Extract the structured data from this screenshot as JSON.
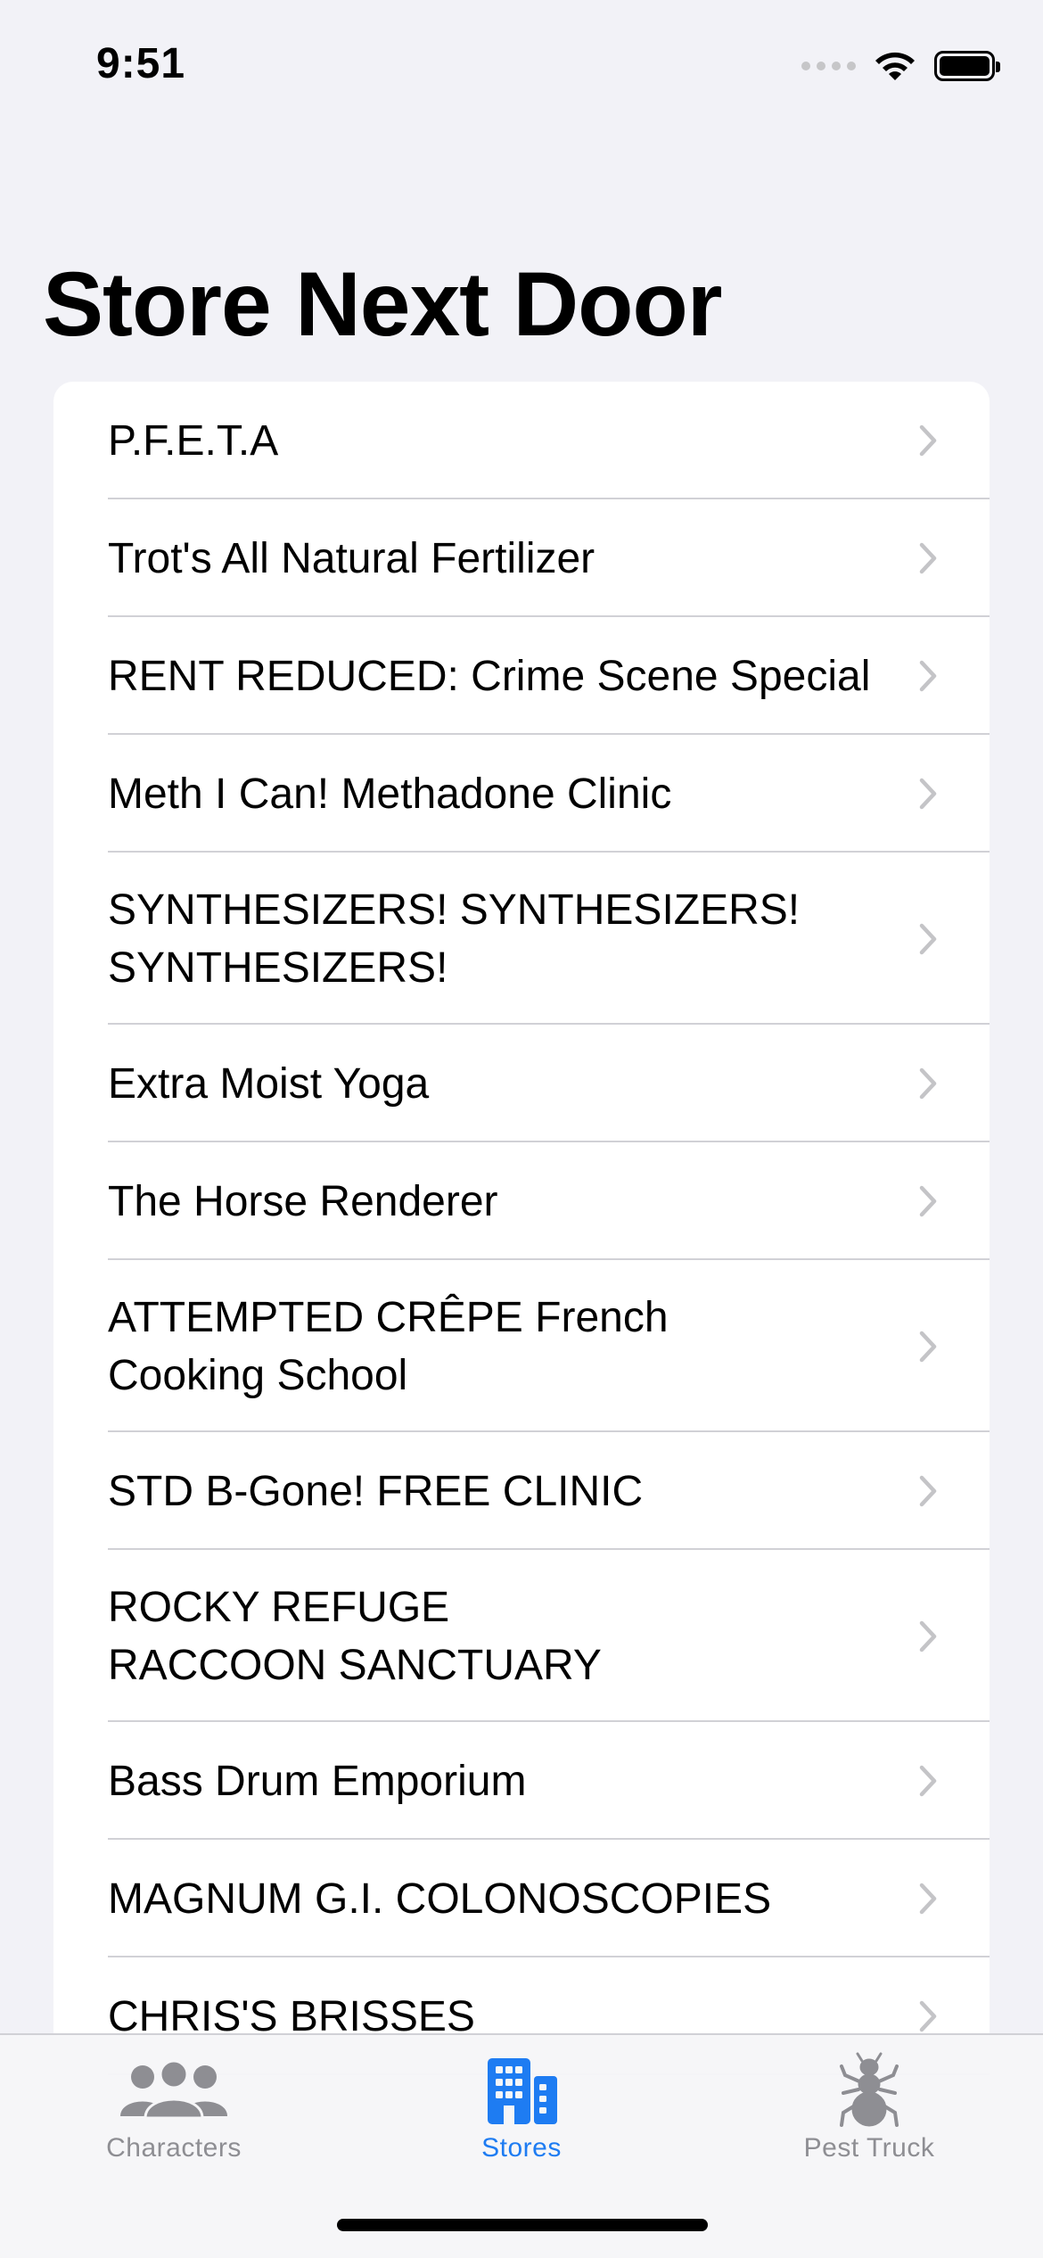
{
  "status_bar": {
    "time": "9:51"
  },
  "nav": {
    "title": "Store Next Door"
  },
  "stores": [
    {
      "lines": [
        "P.F.E.T.A"
      ]
    },
    {
      "lines": [
        "Trot's All Natural Fertilizer"
      ]
    },
    {
      "lines": [
        "RENT REDUCED: Crime Scene Special"
      ]
    },
    {
      "lines": [
        "Meth I Can! Methadone Clinic"
      ]
    },
    {
      "lines": [
        "SYNTHESIZERS! SYNTHESIZERS!",
        "SYNTHESIZERS!"
      ]
    },
    {
      "lines": [
        "Extra Moist Yoga"
      ]
    },
    {
      "lines": [
        "The Horse Renderer"
      ]
    },
    {
      "lines": [
        "ATTEMPTED CRÊPE French",
        "Cooking School"
      ]
    },
    {
      "lines": [
        "STD B-Gone! FREE CLINIC"
      ]
    },
    {
      "lines": [
        "ROCKY REFUGE",
        "RACCOON SANCTUARY"
      ]
    },
    {
      "lines": [
        "Bass Drum Emporium"
      ]
    },
    {
      "lines": [
        "MAGNUM G.I. COLONOSCOPIES"
      ]
    },
    {
      "lines": [
        "CHRIS'S BRISSES"
      ]
    }
  ],
  "tab_bar": {
    "tabs": [
      {
        "label": "Characters",
        "icon": "people-icon",
        "active": false
      },
      {
        "label": "Stores",
        "icon": "building-icon",
        "active": true
      },
      {
        "label": "Pest Truck",
        "icon": "ant-icon",
        "active": false
      }
    ]
  },
  "colors": {
    "background": "#f2f2f7",
    "accent": "#1e7cf2",
    "inactive": "#8e8e93",
    "chevron": "#c4c4c7",
    "separator": "#d1d1d6"
  }
}
